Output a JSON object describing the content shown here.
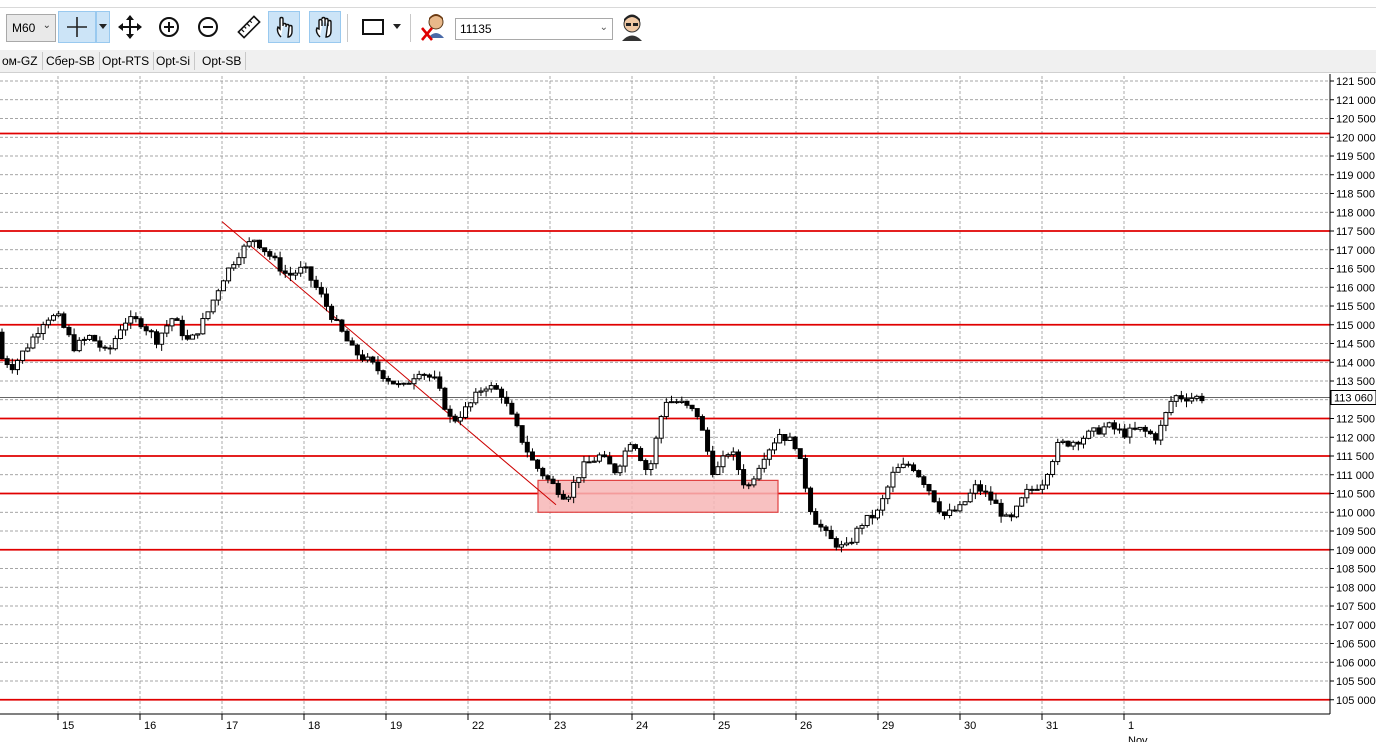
{
  "toolbar": {
    "timeframe": "M60",
    "instrument_field_value": "11135",
    "icons": [
      "crosshair-icon",
      "move-icon",
      "zoom-in-icon",
      "zoom-out-icon",
      "ruler-icon",
      "hand-point-icon",
      "hand-icon",
      "rectangle-icon",
      "trader-remove-icon",
      "trader-icon"
    ]
  },
  "tabs": [
    "ом-GZ",
    "Сбер-SB",
    "Opt-RTS",
    "Opt-Si",
    "Opt-SB"
  ],
  "chart_data": {
    "type": "candlestick",
    "y_ticks": [
      "121 500",
      "121 000",
      "120 500",
      "120 000",
      "119 500",
      "119 000",
      "118 500",
      "118 000",
      "117 500",
      "117 000",
      "116 500",
      "116 000",
      "115 500",
      "115 000",
      "114 500",
      "114 000",
      "113 500",
      "113 000",
      "112 500",
      "112 000",
      "111 500",
      "111 000",
      "110 500",
      "110 000",
      "109 500",
      "109 000",
      "108 500",
      "108 000",
      "107 500",
      "107 000",
      "106 500",
      "106 000",
      "105 500",
      "105 000"
    ],
    "ylim": [
      104800,
      121600
    ],
    "current_price_label": "113 060",
    "current_price": 113060,
    "x_day_labels": [
      "15",
      "16",
      "17",
      "18",
      "19",
      "22",
      "23",
      "24",
      "25",
      "26",
      "29",
      "30",
      "31",
      "1"
    ],
    "x_month_label": "Nov",
    "horizontal_levels": [
      120100,
      117500,
      115000,
      114050,
      112500,
      111500,
      110500,
      109000,
      105000
    ],
    "trendline": {
      "from": {
        "day": "17",
        "price": 117750
      },
      "to": {
        "day": "23",
        "price": 110200
      }
    },
    "zone": {
      "from_day": "23",
      "to_day": "26",
      "price_high": 110850,
      "price_low": 110000
    },
    "colors": {
      "levels": "#e00000",
      "zone_fill": "#f7b6b6",
      "zone_border": "#e04040",
      "trendline": "#cc0000",
      "candles": "#000000",
      "grid": "#888888"
    },
    "grid": "dashed",
    "path_days": [
      {
        "day": "14",
        "prices": [
          114800,
          114200,
          113900,
          114500,
          115200
        ]
      },
      {
        "day": "15",
        "prices": [
          115200,
          114400,
          114700,
          114200,
          115100
        ]
      },
      {
        "day": "16",
        "prices": [
          115100,
          114600,
          115200,
          114500,
          115200
        ]
      },
      {
        "day": "17",
        "prices": [
          116200,
          116900,
          117300,
          116800,
          116300
        ]
      },
      {
        "day": "18",
        "prices": [
          116500,
          115800,
          115000,
          114300,
          114000
        ]
      },
      {
        "day": "19",
        "prices": [
          113600,
          113300,
          113800,
          113500,
          112400
        ]
      },
      {
        "day": "22",
        "prices": [
          112800,
          113400,
          113200,
          112200,
          111300
        ]
      },
      {
        "day": "23",
        "prices": [
          110800,
          110400,
          111200,
          111500,
          111100
        ]
      },
      {
        "day": "24",
        "prices": [
          112000,
          111000,
          113000,
          112900,
          112600
        ]
      },
      {
        "day": "25",
        "prices": [
          111000,
          111700,
          110600,
          111500,
          112100
        ]
      },
      {
        "day": "26",
        "prices": [
          111800,
          109900,
          109300,
          109000,
          109700
        ]
      },
      {
        "day": "29",
        "prices": [
          110000,
          111100,
          111300,
          110700,
          109900
        ]
      },
      {
        "day": "30",
        "prices": [
          110100,
          110700,
          110300,
          109700,
          110500
        ]
      },
      {
        "day": "31",
        "prices": [
          110800,
          111800,
          111900,
          112100,
          112300
        ]
      },
      {
        "day": "1",
        "prices": [
          112100,
          112200,
          112000,
          113100,
          113060
        ]
      }
    ]
  }
}
